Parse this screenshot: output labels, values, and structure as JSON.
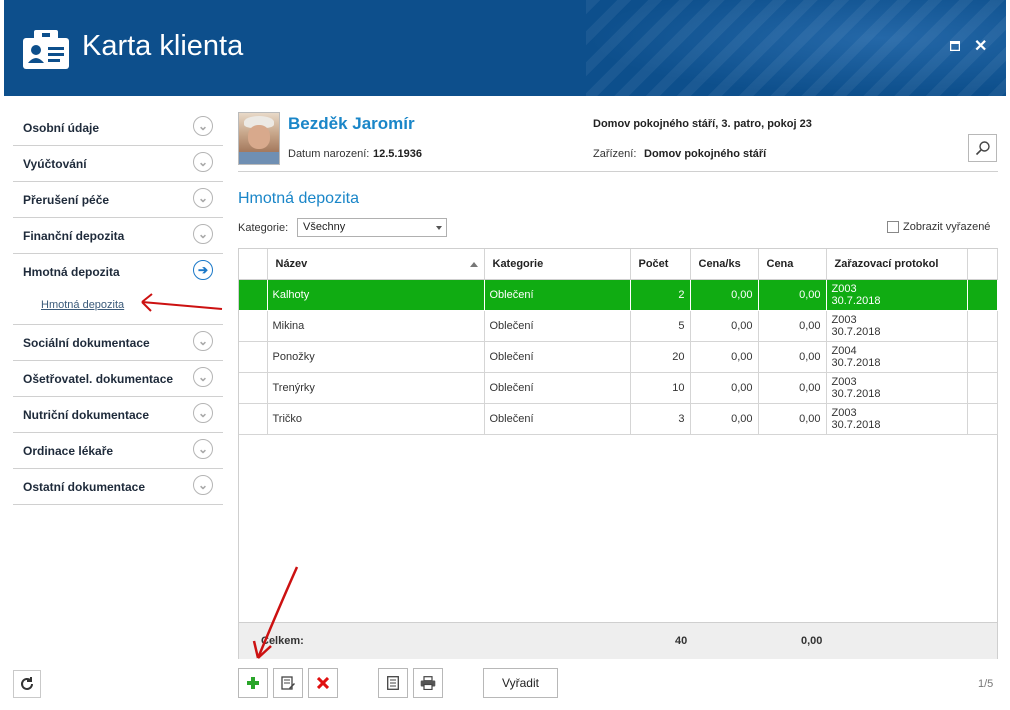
{
  "window": {
    "title": "Karta klienta"
  },
  "sidebar": {
    "items": [
      {
        "label": "Osobní údaje"
      },
      {
        "label": "Vyúčtování"
      },
      {
        "label": "Přerušení péče"
      },
      {
        "label": "Finanční depozita"
      },
      {
        "label": "Hmotná depozita",
        "active": true
      },
      {
        "label": "Sociální dokumentace"
      },
      {
        "label": "Ošetřovatel. dokumentace"
      },
      {
        "label": "Nutriční dokumentace"
      },
      {
        "label": "Ordinace lékaře"
      },
      {
        "label": "Ostatní dokumentace"
      }
    ],
    "sub_item": "Hmotná depozita"
  },
  "client": {
    "name": "Bezděk Jaromír",
    "birth_label": "Datum narození:",
    "birth_date": "12.5.1936",
    "location": "Domov pokojného stáří, 3. patro, pokoj 23",
    "facility_label": "Zařízení:",
    "facility": "Domov pokojného stáří"
  },
  "section": {
    "title": "Hmotná depozita",
    "category_label": "Kategorie:",
    "category_value": "Všechny",
    "show_removed_label": "Zobrazit vyřazené"
  },
  "grid": {
    "columns": [
      "Název",
      "Kategorie",
      "Počet",
      "Cena/ks",
      "Cena",
      "Zařazovací protokol"
    ],
    "rows": [
      {
        "name": "Kalhoty",
        "category": "Oblečení",
        "count": "2",
        "unit_price": "0,00",
        "price": "0,00",
        "protocol": "Z003",
        "protocol_date": "30.7.2018",
        "selected": true
      },
      {
        "name": "Mikina",
        "category": "Oblečení",
        "count": "5",
        "unit_price": "0,00",
        "price": "0,00",
        "protocol": "Z003",
        "protocol_date": "30.7.2018"
      },
      {
        "name": "Ponožky",
        "category": "Oblečení",
        "count": "20",
        "unit_price": "0,00",
        "price": "0,00",
        "protocol": "Z004",
        "protocol_date": "30.7.2018"
      },
      {
        "name": "Trenýrky",
        "category": "Oblečení",
        "count": "10",
        "unit_price": "0,00",
        "price": "0,00",
        "protocol": "Z003",
        "protocol_date": "30.7.2018"
      },
      {
        "name": "Tričko",
        "category": "Oblečení",
        "count": "3",
        "unit_price": "0,00",
        "price": "0,00",
        "protocol": "Z003",
        "protocol_date": "30.7.2018"
      }
    ],
    "footer": {
      "label": "Celkem:",
      "count_total": "40",
      "price_total": "0,00"
    }
  },
  "toolbar": {
    "remove_label": "Vyřadit",
    "pager": "1/5"
  },
  "colors": {
    "titlebar": "#0d4f8c",
    "accent": "#1a86c8",
    "selected_row": "#10ac12",
    "annotation_arrow": "#cc1111",
    "delete_icon": "#e01010",
    "add_icon": "#2aa52a"
  },
  "icons": [
    "client-card-icon",
    "maximize-icon",
    "close-icon",
    "chevron-down-circle-icon",
    "arrow-right-circle-icon",
    "search-icon",
    "refresh-icon",
    "add-icon",
    "edit-icon",
    "delete-icon",
    "document-icon",
    "print-icon"
  ]
}
